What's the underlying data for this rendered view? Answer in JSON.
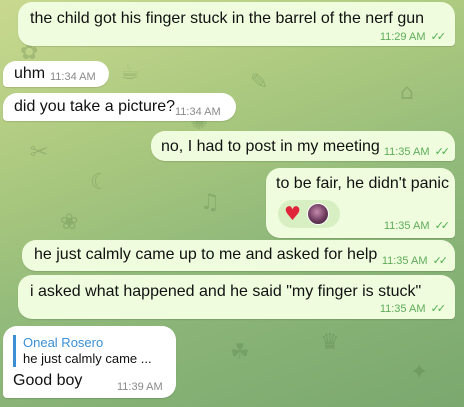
{
  "messages": [
    {
      "text": "the child got his finger stuck in the barrel of the nerf gun",
      "time": "11:29 AM",
      "status": "✓✓"
    },
    {
      "text": "uhm",
      "time": "11:34 AM"
    },
    {
      "text": "did you take a picture?",
      "time": "11:34 AM"
    },
    {
      "text": "no, I had to post in my meeting",
      "time": "11:35 AM",
      "status": "✓✓"
    },
    {
      "text": "to be fair, he didn't panic",
      "time": "11:35 AM",
      "status": "✓✓",
      "reaction": "♥"
    },
    {
      "text": "he just calmly came up to me and asked for help",
      "time": "11:35 AM",
      "status": "✓✓"
    },
    {
      "text": "i asked what happened and he said \"my finger is stuck\"",
      "time": "11:35 AM",
      "status": "✓✓"
    },
    {
      "reply_name": "Oneal Rosero",
      "reply_text": "he just calmly came ...",
      "text": "Good boy",
      "time": "11:39 AM"
    }
  ],
  "colors": {
    "outgoing_bubble": "#effdde",
    "incoming_bubble": "#ffffff",
    "accent": "#3a8fd6",
    "reaction": "#e0243a"
  }
}
